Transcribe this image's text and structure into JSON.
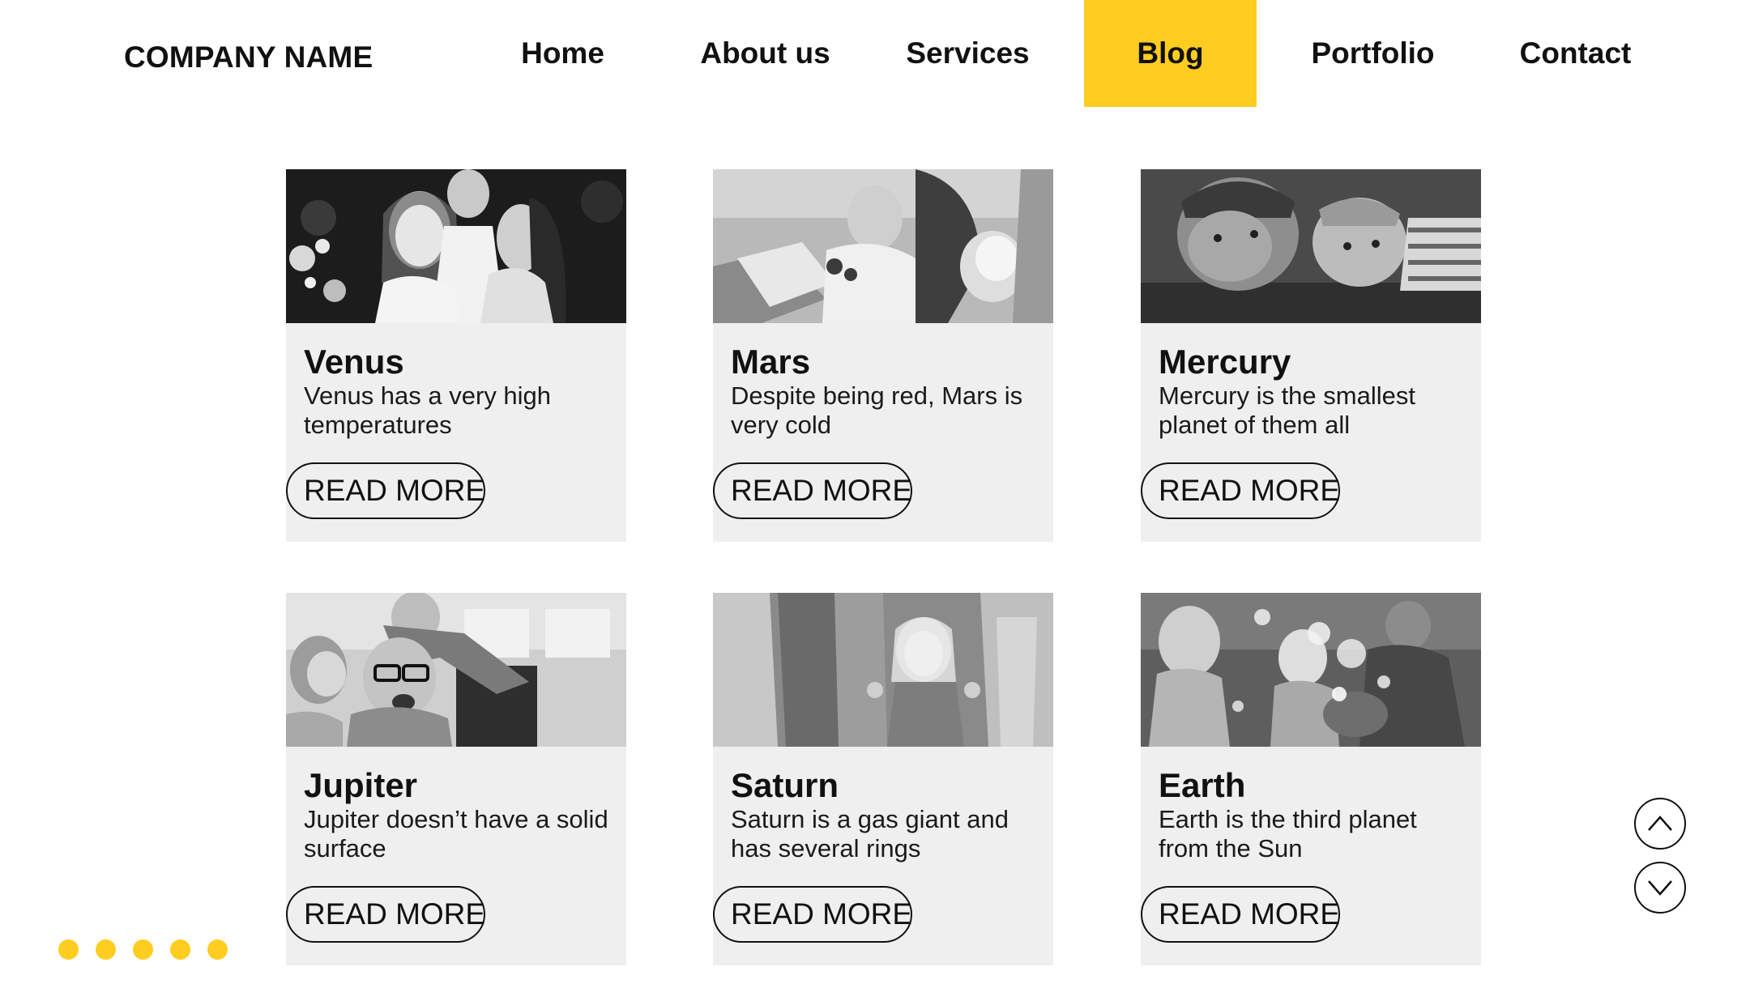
{
  "header": {
    "company": "COMPANY NAME",
    "nav": [
      {
        "label": "Home",
        "active": false
      },
      {
        "label": "About us",
        "active": false
      },
      {
        "label": "Services",
        "active": false
      },
      {
        "label": "Blog",
        "active": true
      },
      {
        "label": "Portfolio",
        "active": false
      },
      {
        "label": "Contact",
        "active": false
      }
    ]
  },
  "cards": [
    {
      "title": "Venus",
      "desc": "Venus has a very high temperatures",
      "button": "READ MORE",
      "image": "family-photo"
    },
    {
      "title": "Mars",
      "desc": "Despite being red, Mars is very cold",
      "button": "READ MORE",
      "image": "mother-child-reading-photo"
    },
    {
      "title": "Mercury",
      "desc": "Mercury is the smallest planet of them all",
      "button": "READ MORE",
      "image": "father-child-lying-photo"
    },
    {
      "title": "Jupiter",
      "desc": "Jupiter doesn’t have a solid surface",
      "button": "READ MORE",
      "image": "father-piggyback-photo"
    },
    {
      "title": "Saturn",
      "desc": "Saturn is a gas giant and has several rings",
      "button": "READ MORE",
      "image": "girl-holding-hands-photo"
    },
    {
      "title": "Earth",
      "desc": "Earth is the third planet from the Sun",
      "button": "READ MORE",
      "image": "family-picnic-bubbles-photo"
    }
  ],
  "controls": {
    "scroll_up_icon": "chevron-up-icon",
    "scroll_down_icon": "chevron-down-icon",
    "dot_count": 5
  },
  "colors": {
    "accent": "#FFCD1F",
    "card_background": "#efefef",
    "text": "#111111"
  }
}
